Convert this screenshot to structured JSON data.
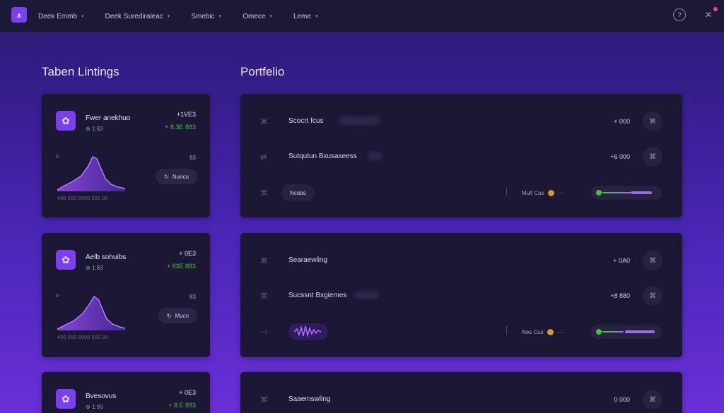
{
  "nav": {
    "items": [
      "Deek Emmb",
      "Deek Surediraleac",
      "Smebic",
      "Omece",
      "Leme"
    ]
  },
  "listings": {
    "title": "Taben Lintings",
    "cards": [
      {
        "name": "Fwer anekhuo",
        "sub_icon": "⊕",
        "sub": "1:83",
        "pct": "+1VE3",
        "pct2": "+ 8.3E 883",
        "ylab": "0",
        "ylab2": "83",
        "xlab": "400 000 6000 000 00",
        "pill": "Nunco"
      },
      {
        "name": "Aelb sohuibs",
        "sub_icon": "⊕",
        "sub": "1:83",
        "pct": "+ 0E3",
        "pct2": "+ 83E 883",
        "ylab": "0",
        "ylab2": "83",
        "xlab": "400 000 6000 000 00",
        "pill": "Mucn"
      },
      {
        "name": "Bvesovus",
        "sub_icon": "⊕",
        "sub": "1:93",
        "pct": "+ 0E3",
        "pct2": "+ 8 E 883",
        "ylab": "",
        "ylab2": "",
        "xlab": "",
        "pill": ""
      }
    ]
  },
  "portfolio": {
    "title": "Portfelio",
    "panels": [
      {
        "rows": [
          {
            "label": "Scocrt fcus",
            "value": "+ 000"
          },
          {
            "label": "Sutqutun Bxusaseess",
            "value": "+6 000"
          }
        ],
        "chip": "Ncabs",
        "meta": "Mult Cus",
        "meta_dash": "—"
      },
      {
        "rows": [
          {
            "label": "Searaewling",
            "value": "+ 0A0"
          },
          {
            "label": "Sucssnt Bxgiemes",
            "value": "+8 880"
          }
        ],
        "chip": "",
        "meta": "Nes Cus",
        "meta_dash": "—"
      },
      {
        "rows": [
          {
            "label": "Saaemswling",
            "value": "0 000"
          }
        ]
      }
    ]
  },
  "colors": {
    "accent": "#7b3ff2",
    "positive": "#3ec43e",
    "panel": "#1b1735"
  }
}
